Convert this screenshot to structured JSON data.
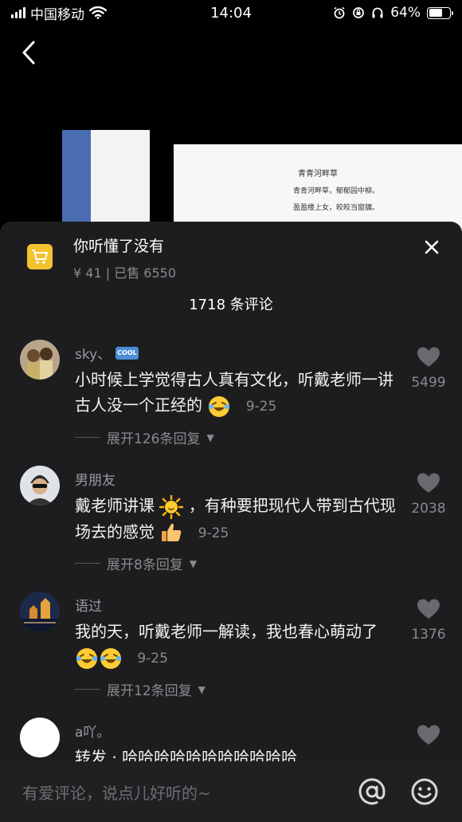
{
  "status_bar": {
    "carrier": "中国移动",
    "time": "14:04",
    "battery": "64%",
    "battery_level": 0.64
  },
  "background": {
    "poem_title": "青青河畔草",
    "poem_lines": [
      "青青河畔草，郁郁园中柳。",
      "盈盈楼上女，皎皎当窗牖。"
    ]
  },
  "product": {
    "title": "你听懂了没有",
    "price": "¥ 41",
    "sold": "已售 6550",
    "icon": "shopping-cart-icon"
  },
  "comments_header": "1718 条评论",
  "comments": [
    {
      "user": "sky、",
      "badge": "COOL",
      "text": "小时候上学觉得古人真有文化，听戴老师一讲古人没一个正经的",
      "emoji": [
        "laughing-tears-emoji"
      ],
      "date": "9-25",
      "likes": "5499",
      "expand": "展开126条回复"
    },
    {
      "user": "男朋友",
      "text_parts": [
        "戴老师讲课",
        "，有种要把现代人带到古代现场去的感觉"
      ],
      "emoji": [
        "sun-emoji",
        "thumbs-up-emoji"
      ],
      "date": "9-25",
      "likes": "2038",
      "expand": "展开8条回复"
    },
    {
      "user": "语过",
      "text": "我的天，听戴老师一解读，我也春心萌动了",
      "emoji": [
        "laughing-tears-emoji",
        "laughing-tears-emoji"
      ],
      "date": "9-25",
      "likes": "1376",
      "expand": "展开12条回复"
    },
    {
      "user": "a吖。",
      "text": "转发 · 哈哈哈哈哈哈哈哈哈哈哈"
    }
  ],
  "input": {
    "placeholder": "有爱评论，说点儿好听的~"
  },
  "colors": {
    "sheet_bg": "#1d1d20",
    "input_bg": "#202023",
    "muted_text": "#8a8a8e",
    "cart_yellow": "#f3c22f"
  }
}
